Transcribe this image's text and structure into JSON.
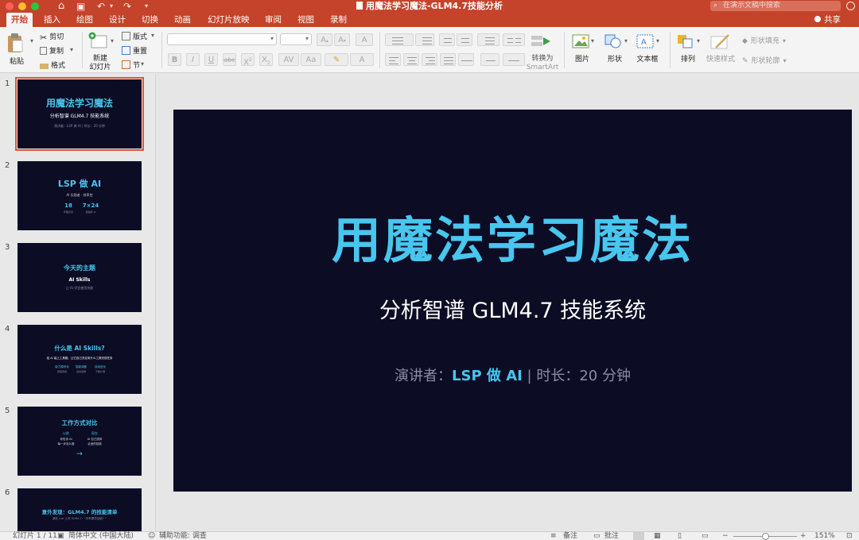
{
  "window": {
    "title": "用魔法学习魔法-GLM4.7技能分析",
    "search_placeholder": "在演示文稿中搜索",
    "share_label": "共享"
  },
  "tabs": [
    "开始",
    "插入",
    "绘图",
    "设计",
    "切换",
    "动画",
    "幻灯片放映",
    "审阅",
    "视图",
    "录制"
  ],
  "active_tab": "开始",
  "ribbon": {
    "paste": "粘贴",
    "cut": "剪切",
    "copy": "复制",
    "format": "格式",
    "new_slide_line1": "新建",
    "new_slide_line2": "幻灯片",
    "layout": "版式",
    "reset": "重置",
    "section": "节",
    "convert_smartart_line1": "转换为",
    "convert_smartart_line2": "SmartArt",
    "picture": "图片",
    "shape": "形状",
    "textbox": "文本框",
    "arrange": "排列",
    "quick_styles": "快速样式",
    "shape_fill": "形状填充",
    "shape_outline": "形状轮廓"
  },
  "thumbnails": [
    {
      "num": "1",
      "title": "用魔法学习魔法",
      "subtitle": "分析智谱 GLM4.7 技能系统",
      "meta": "演讲者：LSP 做 AI | 时长：20 分钟"
    },
    {
      "num": "2",
      "title": "LSP 做 AI",
      "subtitle": "AI 实践者 · 效率控",
      "stat1_value": "18",
      "stat1_label": "年程序员",
      "stat2_value": "7×24",
      "stat2_label": "连轴转 AI"
    },
    {
      "num": "3",
      "title": "今天的主题",
      "subtitle": "AI Skills",
      "meta": "让 AI 学会使用技能"
    },
    {
      "num": "4",
      "title": "什么是 AI Skills?",
      "subtitle": "给 AI 装上工具箱，让它自己决定用什么工具完成任务",
      "col1_title": "能力模块化",
      "col1_text": "按需调用",
      "col2_title": "智能调度",
      "col2_text": "自动选择",
      "col3_title": "持续进化",
      "col3_text": "不断扩展"
    },
    {
      "num": "5",
      "title": "工作方式对比",
      "left_title": "以前",
      "left_line1": "你告诉 AI",
      "left_line2": "每一步怎么做",
      "right_title": "现在",
      "right_line1": "AI 自己选择",
      "right_line2": "合适的技能",
      "arrow": "→"
    },
    {
      "num": "6",
      "title": "意外发现：GLM4.7 的技能清单",
      "subtitle": "我在 z.ai 上问 GLM4.7：\"你有哪些技能？\""
    }
  ],
  "slide": {
    "title": "用魔法学习魔法",
    "subtitle": "分析智谱 GLM4.7 技能系统",
    "meta_prefix": "演讲者：",
    "meta_speaker": "LSP 做 AI",
    "meta_suffix": " | 时长：20 分钟"
  },
  "statusbar": {
    "slide_count": "幻灯片 1 / 11",
    "language": "简体中文 (中国大陆)",
    "accessibility": "辅助功能: 调查",
    "notes": "备注",
    "comments": "批注",
    "zoom": "151%"
  },
  "colors": {
    "accent": "#c4432a",
    "slide_bg": "#0c0c24",
    "title_blue": "#48c6ee",
    "meta_gray": "#8c8ca4"
  }
}
